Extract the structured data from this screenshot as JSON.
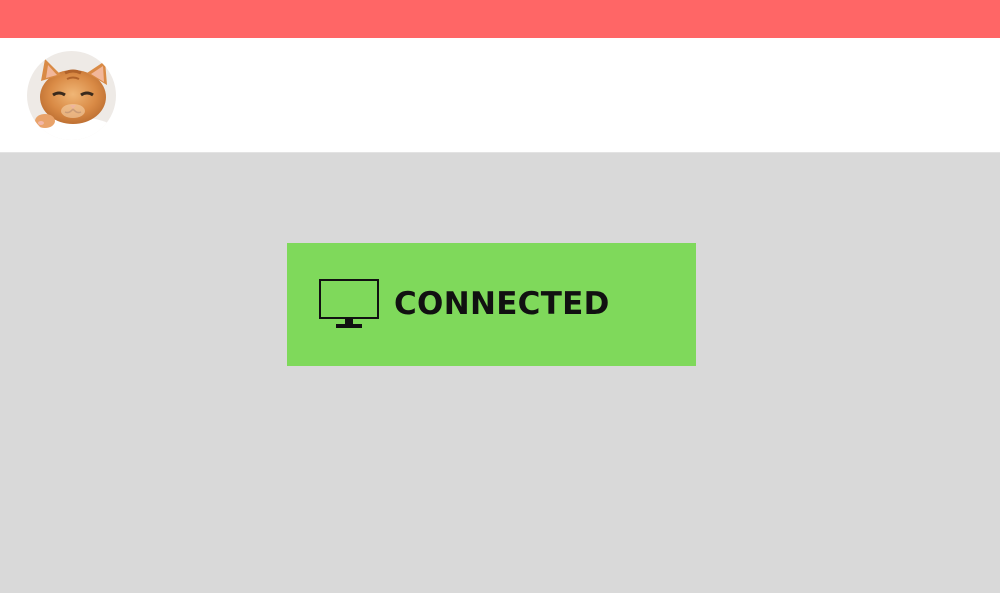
{
  "colors": {
    "top_bar": "#ff6666",
    "main_background": "#d9d9d9",
    "status_background": "#7fd95b",
    "status_text": "#111111"
  },
  "header": {
    "avatar_icon": "kitten-avatar"
  },
  "status": {
    "icon": "monitor-icon",
    "label": "CONNECTED"
  }
}
